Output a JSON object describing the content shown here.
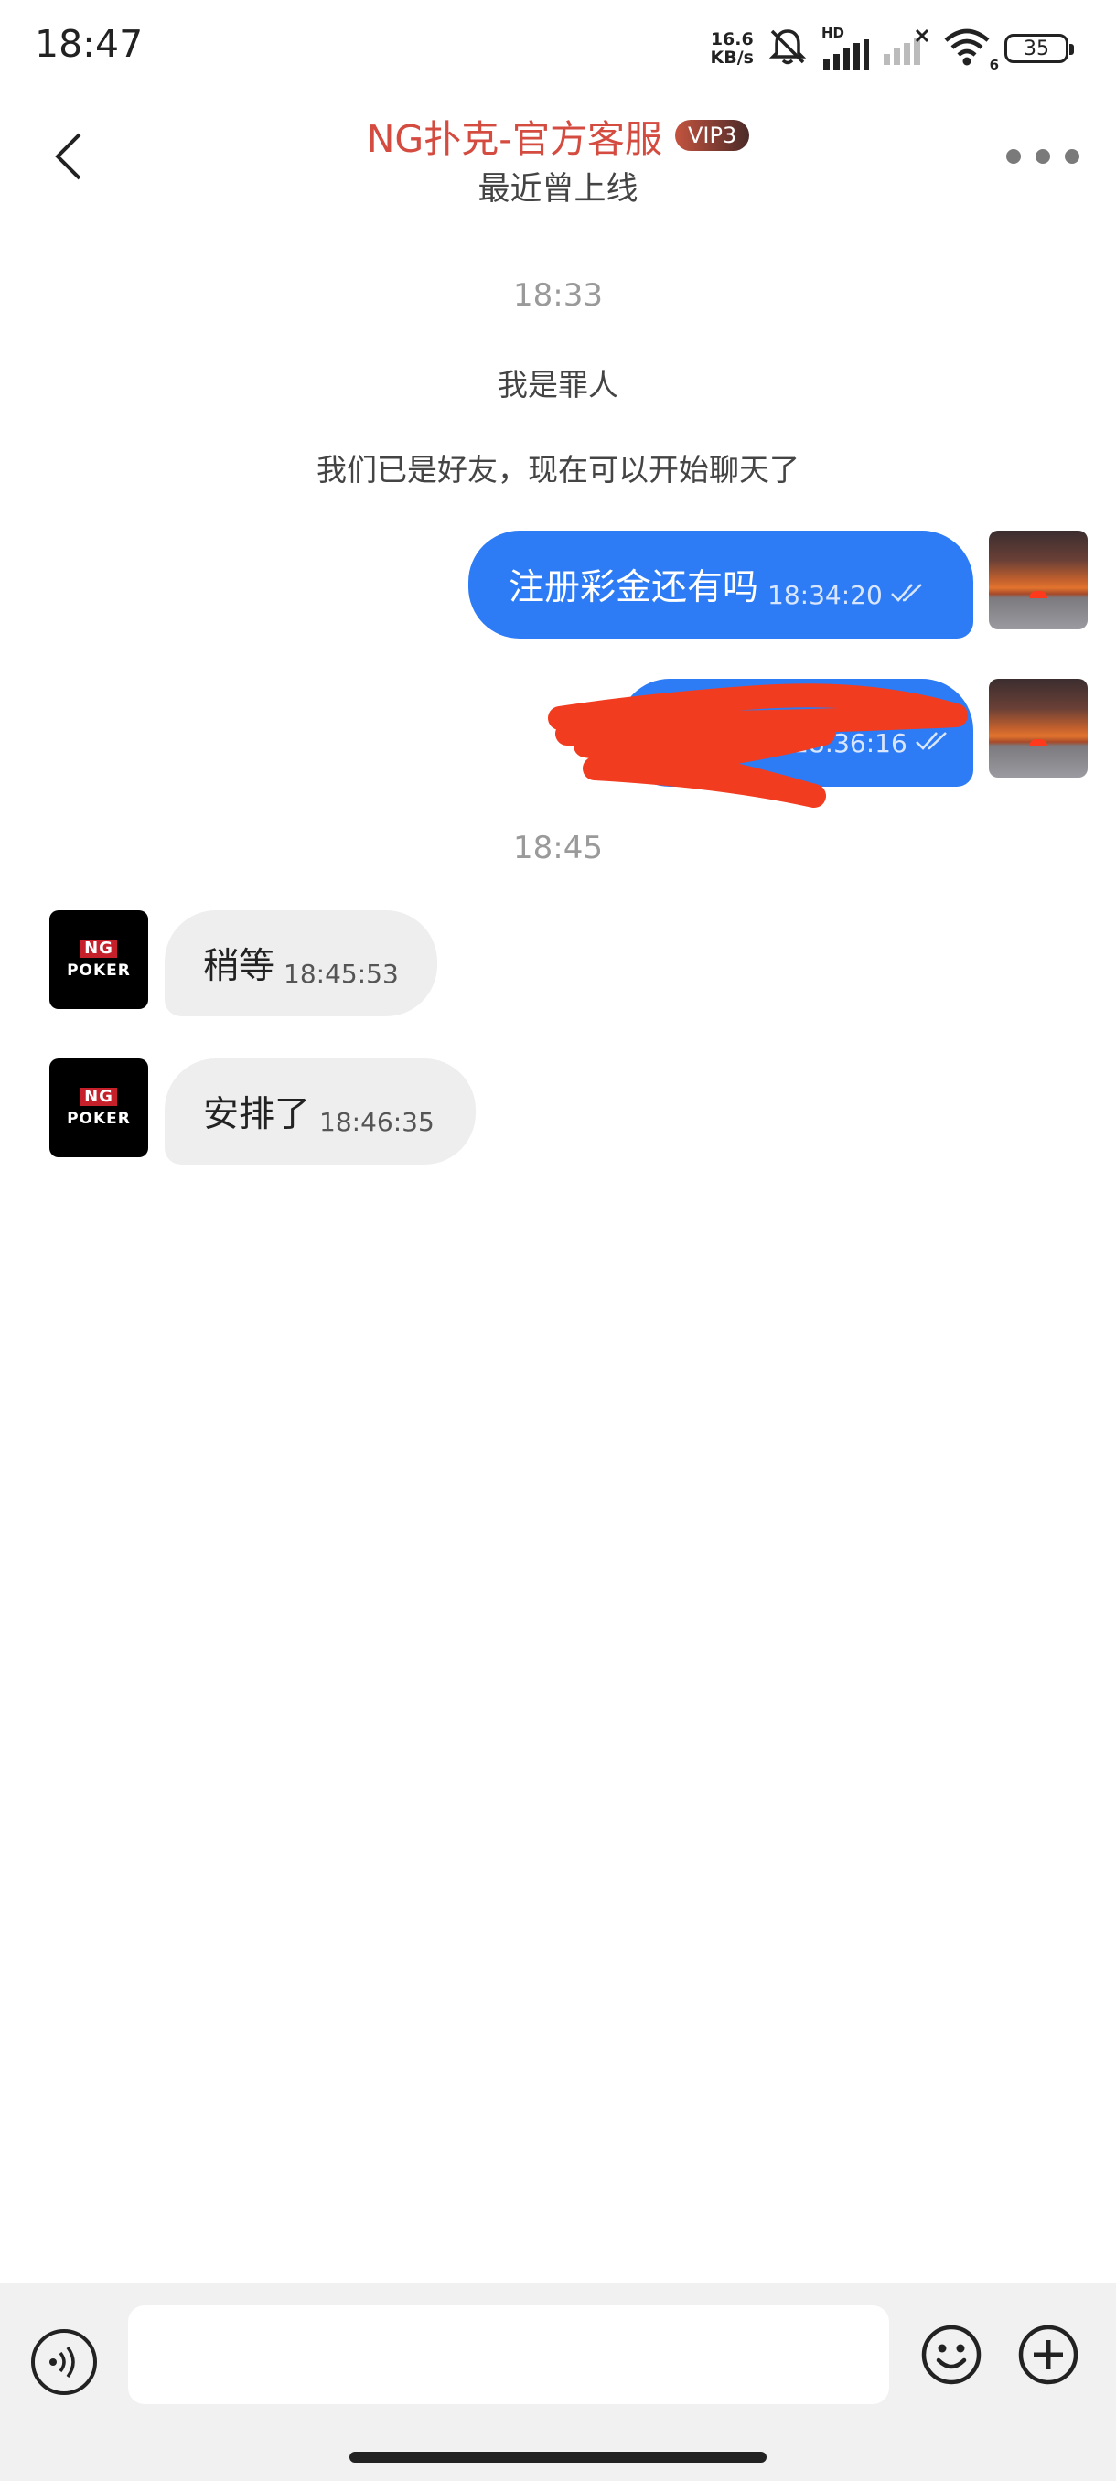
{
  "status_bar": {
    "time": "18:47",
    "net_speed_value": "16.6",
    "net_speed_unit": "KB/s",
    "hd_label": "HD",
    "wifi_badge": "6",
    "battery_level": "35"
  },
  "header": {
    "title": "NG扑克-官方客服",
    "vip_badge": "VIP3",
    "subtitle": "最近曾上线"
  },
  "chat": {
    "timestamp_1": "18:33",
    "system_msg_1": "我是罪人",
    "system_msg_2": "我们已是好友，现在可以开始聊天了",
    "messages": [
      {
        "direction": "out",
        "text": "注册彩金还有吗",
        "time": "18:34:20",
        "read": true
      },
      {
        "direction": "out",
        "text": "",
        "time": "18:36:16",
        "read": true,
        "redacted": true
      },
      {
        "direction": "in",
        "text": "稍等",
        "time": "18:45:53"
      },
      {
        "direction": "in",
        "text": "安排了",
        "time": "18:46:35"
      }
    ],
    "timestamp_2": "18:45",
    "agent_avatar_logo_top": "NG",
    "agent_avatar_logo_bottom": "POKER"
  },
  "input_bar": {
    "placeholder": ""
  },
  "colors": {
    "accent_blue": "#2d7cf6",
    "title_red": "#d44b40",
    "incoming_bubble": "#eeeeee"
  }
}
